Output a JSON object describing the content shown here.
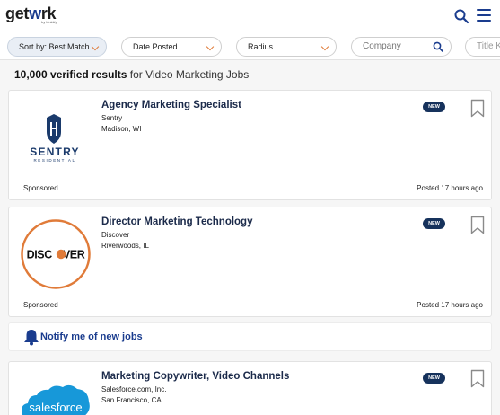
{
  "header": {
    "logo_text_1": "get",
    "logo_text_2": "w",
    "logo_text_3": "rk",
    "logo_sub": "by LinkUp",
    "search_icon": "search-icon",
    "menu_icon": "hamburger-menu-icon",
    "accent_color": "#1a3c8e"
  },
  "filters": {
    "sort": "Sort by: Best Match",
    "date": "Date Posted",
    "radius": "Radius",
    "company_placeholder": "Company",
    "title_placeholder": "Title K"
  },
  "results": {
    "count": "10,000 verified results",
    "suffix": " for Video Marketing Jobs"
  },
  "jobs": [
    {
      "title": "Agency Marketing Specialist",
      "company": "Sentry",
      "location": "Madison, WI",
      "badge": "NEW",
      "sponsored": "Sponsored",
      "posted": "Posted 17 hours ago",
      "logo_text": "SENTRY",
      "logo_sub": "RESIDENTIAL"
    },
    {
      "title": "Director Marketing Technology",
      "company": "Discover",
      "location": "Riverwoods, IL",
      "badge": "NEW",
      "sponsored": "Sponsored",
      "posted": "Posted 17 hours ago",
      "logo_text_1": "DISC",
      "logo_text_2": "VER"
    },
    {
      "title": "Marketing Copywriter, Video Channels",
      "company": "Salesforce.com, Inc.",
      "location": "San Francisco, CA",
      "badge": "NEW",
      "logo_text": "salesforce"
    }
  ],
  "notify": {
    "label": "Notify me of new jobs",
    "icon": "bell-icon"
  },
  "colors": {
    "badge": "#16325c",
    "chevron": "#e07b39",
    "title": "#1b2a4a",
    "discover_orange": "#e07b39",
    "salesforce_blue": "#1798d9"
  }
}
